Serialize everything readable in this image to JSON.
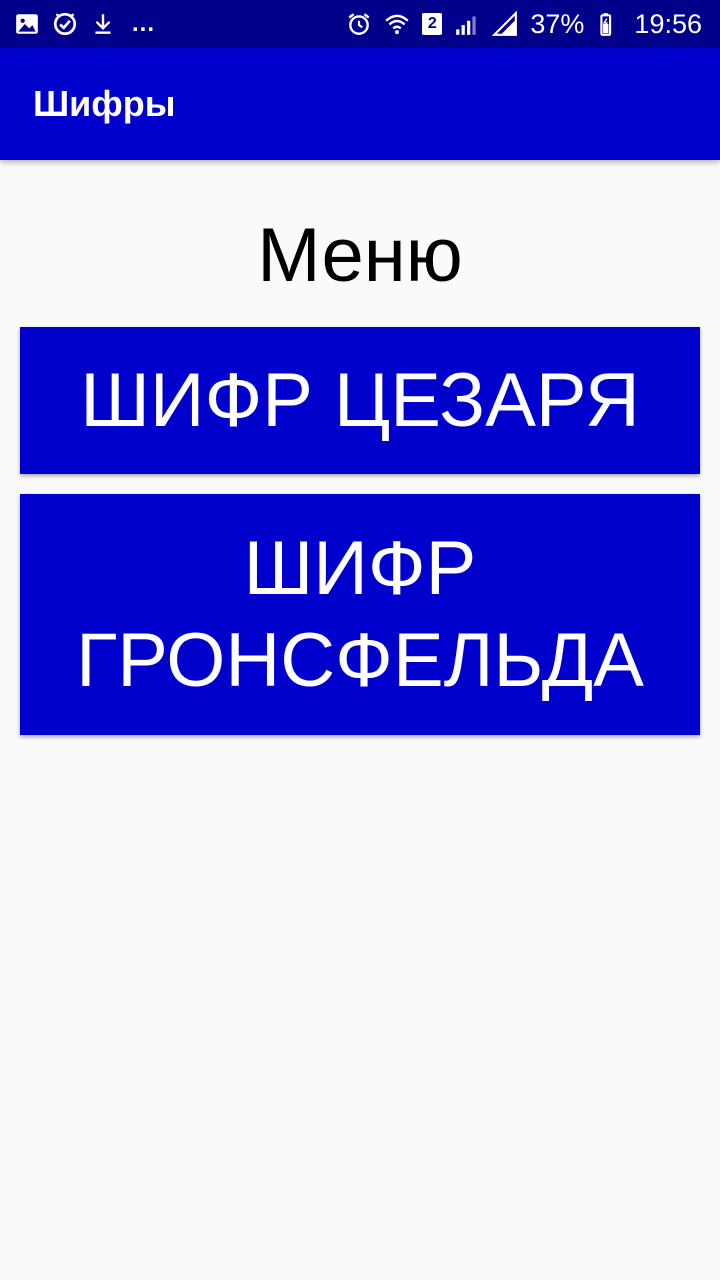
{
  "status_bar": {
    "left_icons": [
      "image-icon",
      "check-circle-icon",
      "download-icon"
    ],
    "more": "...",
    "sim": "2",
    "battery_percent": "37%",
    "time": "19:56"
  },
  "app_bar": {
    "title": "Шифры"
  },
  "main": {
    "heading": "Меню",
    "buttons": [
      {
        "label": "ШИФР ЦЕЗАРЯ"
      },
      {
        "label": "ШИФР ГРОНСФЕЛЬДА"
      }
    ]
  },
  "colors": {
    "status_bar": "#00008b",
    "accent": "#0000cd",
    "background": "#fafafa",
    "text_on_accent": "#ffffff"
  }
}
